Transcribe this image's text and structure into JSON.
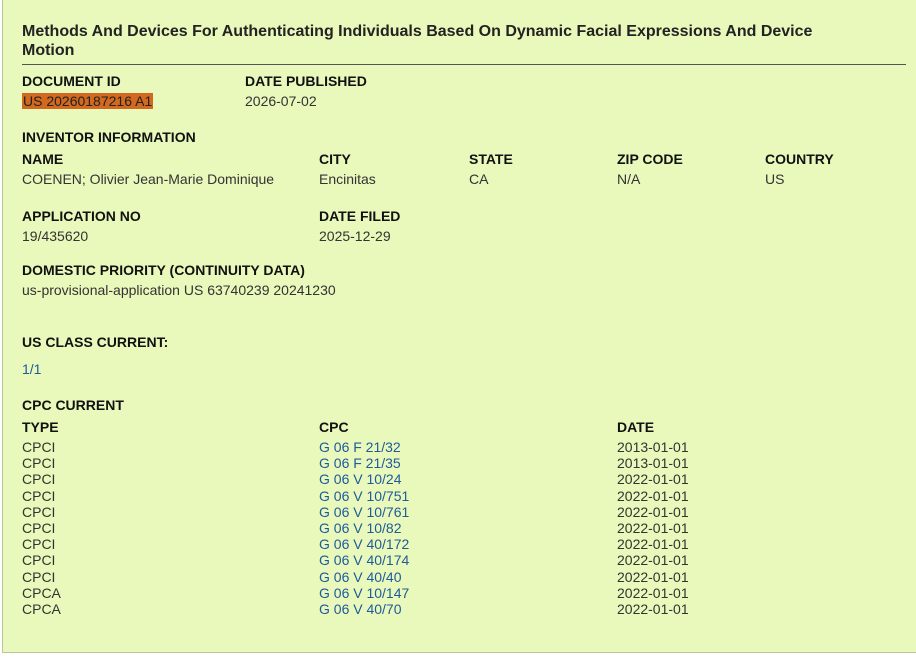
{
  "title": "Methods And Devices For Authenticating Individuals Based On Dynamic Facial Expressions And Device Motion",
  "document": {
    "id_label": "DOCUMENT ID",
    "id_value": "US 20260187216 A1",
    "published_label": "DATE PUBLISHED",
    "published_value": "2026-07-02"
  },
  "inventor": {
    "section_label": "INVENTOR INFORMATION",
    "name_label": "NAME",
    "city_label": "CITY",
    "state_label": "STATE",
    "zip_label": "ZIP CODE",
    "country_label": "COUNTRY",
    "name": "COENEN; Olivier Jean-Marie Dominique",
    "city": "Encinitas",
    "state": "CA",
    "zip": "N/A",
    "country": "US"
  },
  "application": {
    "no_label": "APPLICATION NO",
    "no_value": "19/435620",
    "filed_label": "DATE FILED",
    "filed_value": "2025-12-29"
  },
  "priority": {
    "label": "DOMESTIC PRIORITY (CONTINUITY DATA)",
    "value": "us-provisional-application US 63740239 20241230"
  },
  "us_class": {
    "label": "US CLASS CURRENT:",
    "link": "1/1"
  },
  "cpc": {
    "label": "CPC CURRENT",
    "headers": {
      "type": "TYPE",
      "cpc": "CPC",
      "date": "DATE"
    },
    "rows": [
      {
        "type": "CPCI",
        "cpc": "G 06 F 21/32",
        "date": "2013-01-01"
      },
      {
        "type": "CPCI",
        "cpc": "G 06 F 21/35",
        "date": "2013-01-01"
      },
      {
        "type": "CPCI",
        "cpc": "G 06 V 10/24",
        "date": "2022-01-01"
      },
      {
        "type": "CPCI",
        "cpc": "G 06 V 10/751",
        "date": "2022-01-01"
      },
      {
        "type": "CPCI",
        "cpc": "G 06 V 10/761",
        "date": "2022-01-01"
      },
      {
        "type": "CPCI",
        "cpc": "G 06 V 10/82",
        "date": "2022-01-01"
      },
      {
        "type": "CPCI",
        "cpc": "G 06 V 40/172",
        "date": "2022-01-01"
      },
      {
        "type": "CPCI",
        "cpc": "G 06 V 40/174",
        "date": "2022-01-01"
      },
      {
        "type": "CPCI",
        "cpc": "G 06 V 40/40",
        "date": "2022-01-01"
      },
      {
        "type": "CPCA",
        "cpc": "G 06 V 10/147",
        "date": "2022-01-01"
      },
      {
        "type": "CPCA",
        "cpc": "G 06 V 40/70",
        "date": "2022-01-01"
      }
    ]
  },
  "colors": {
    "panel_bg": "#e9f8bb",
    "link": "#1f5a9a",
    "highlight": "#d2691e"
  }
}
